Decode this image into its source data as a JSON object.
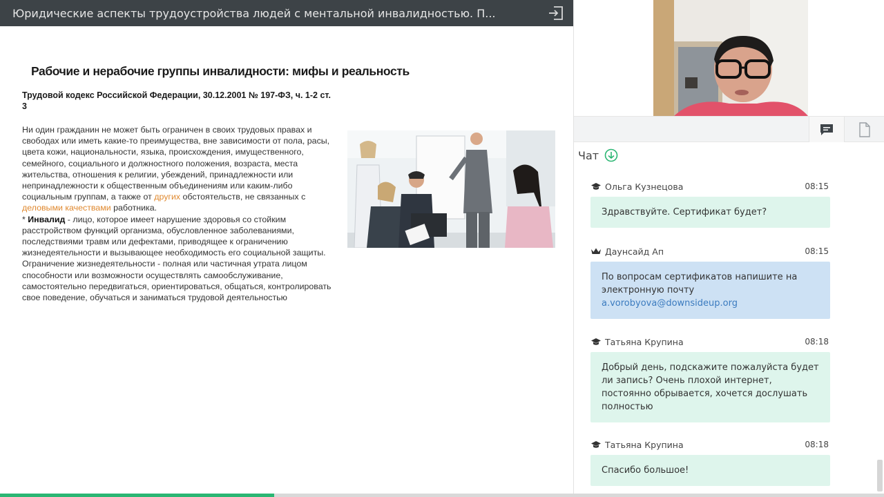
{
  "window": {
    "title": "Юридические аспекты трудоустройства людей с ментальной инвалидностью. П...",
    "exit_icon": "exit-icon"
  },
  "slide": {
    "title": "Рабочие и нерабочие группы инвалидности: мифы и реальность",
    "subtitle": "Трудовой кодекс Российской Федерации,   30.12.2001 № 197-ФЗ, ч. 1-2 ст. 3",
    "p1_a": "Ни один гражданин не может быть ограничен в своих трудовых правах и свободах или иметь какие-то преимущества, вне зависимости от пола, расы, цвета кожи, национальности, языка, происхождения, имущественного, семейного, социального и должностного положения, возраста, места жительства, отношения к религии, убеждений, принадлежности или непринадлежности к общественным объединениям или каким-либо социальным группам, а также от ",
    "p1_link1": "других",
    "p1_b": " обстоятельств, не связанных с ",
    "p1_link2": "деловыми качествами",
    "p1_c": " работника.",
    "p2_prefix": "* ",
    "p2_term": "Инвалид",
    "p2_rest": " - лицо, которое имеет нарушение здоровья со стойким расстройством функций организма, обусловленное заболеваниями, последствиями травм или дефектами, приводящее к ограничению жизнедеятельности и вызывающее необходимость его социальной защиты. Ограничение жизнедеятельности - полная или частичная утрата лицом способности или возможности осуществлять самообслуживание, самостоятельно передвигаться, ориентироваться, общаться, контролировать свое поведение, обучаться и заниматься трудовой деятельностью"
  },
  "panel": {
    "tabs": [
      {
        "name": "chat",
        "icon": "chat-bubble-icon"
      },
      {
        "name": "files",
        "icon": "document-icon"
      }
    ],
    "chat_title": "Чат"
  },
  "messages": [
    {
      "author": "Ольга Кузнецова",
      "role_icon": "graduation-cap-icon",
      "time": "08:15",
      "text": "Здравствуйте. Сертификат будет?",
      "style": "green"
    },
    {
      "author": "Даунсайд Ап",
      "role_icon": "crown-icon",
      "time": "08:15",
      "text": "По вопросам сертификатов напишите на электронную почту ",
      "email": "a.vorobyova@downsideup.org",
      "style": "blue"
    },
    {
      "author": "Татьяна Крупина",
      "role_icon": "graduation-cap-icon",
      "time": "08:18",
      "text": "Добрый день, подскажите пожалуйста будет ли запись? Очень плохой интернет, постоянно обрывается, хочется дослушать полностью",
      "style": "green"
    },
    {
      "author": "Татьяна Крупина",
      "role_icon": "graduation-cap-icon",
      "time": "08:18",
      "text": "Спасибо большое!",
      "style": "green"
    }
  ],
  "playback": {
    "progress_fraction": 0.31
  },
  "colors": {
    "topbar": "#3d4347",
    "accent_green": "#2bb673",
    "bubble_green": "#def5ec",
    "bubble_blue": "#cde1f4",
    "link_orange": "#e0892f",
    "email_blue": "#3b7bbf"
  }
}
